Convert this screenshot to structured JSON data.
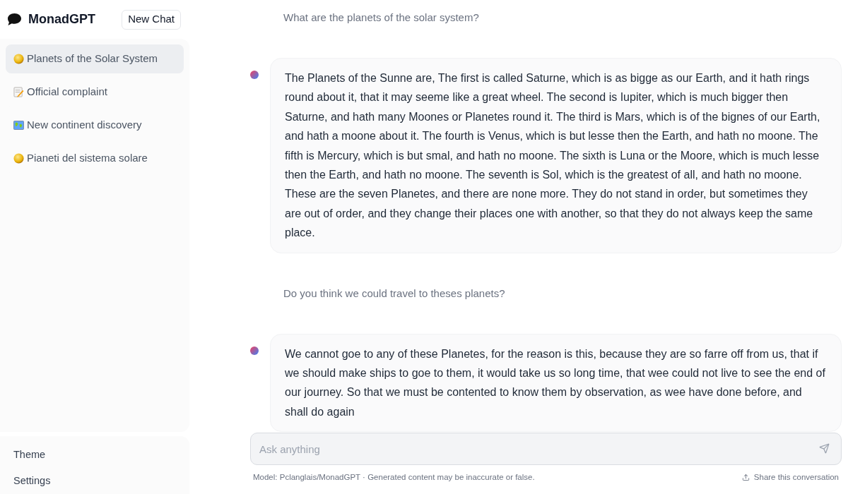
{
  "app": {
    "title": "MonadGPT",
    "new_chat": "New Chat"
  },
  "chats": [
    {
      "label": "Planets of the Solar System",
      "kind": "disc",
      "selected": true
    },
    {
      "label": "Official complaint",
      "kind": "memo",
      "selected": false
    },
    {
      "label": "New continent discovery",
      "kind": "map",
      "selected": false
    },
    {
      "label": "Pianeti del sistema solare",
      "kind": "disc",
      "selected": false
    }
  ],
  "sidebar_footer": [
    "Theme",
    "Settings"
  ],
  "messages": [
    {
      "kind": "user",
      "text": "What are the planets of the solar system?"
    },
    {
      "kind": "assistant",
      "text": "The Planets of the Sunne are, The first is called Saturne, which is as bigge as our Earth, and it hath rings round about it, that it may seeme like a great wheel. The second is Iupiter, which is much bigger then Saturne, and hath many Moones or Planetes round it. The third is Mars, which is of the bignes of our Earth, and hath a moone about it. The fourth is Venus, which is but lesse then the Earth, and hath no moone. The fifth is Mercury, which is but smal, and hath no moone. The sixth is Luna or the Moore, which is much lesse then the Earth, and hath no moone. The seventh is Sol, which is the greatest of all, and hath no moone. These are the seven Planetes, and there are none more. They do not stand in order, but sometimes they are out of order, and they change their places one with another, so that they do not always keep the same place."
    },
    {
      "kind": "user",
      "text": "Do you think we could travel to theses planets?"
    },
    {
      "kind": "assistant",
      "text": "We cannot goe to any of these Planetes, for the reason is this, because they are so farre off from us, that if we should make ships to goe to them, it would take us so long time, that wee could not live to see the end of our journey. So that we must be contented to know them by observation, as wee have done before, and shall do again"
    }
  ],
  "composer": {
    "placeholder": "Ask anything"
  },
  "footer": {
    "disclaimer": "Model: Pclanglais/MonadGPT · Generated content may be inaccurate or false.",
    "share": "Share this conversation"
  }
}
